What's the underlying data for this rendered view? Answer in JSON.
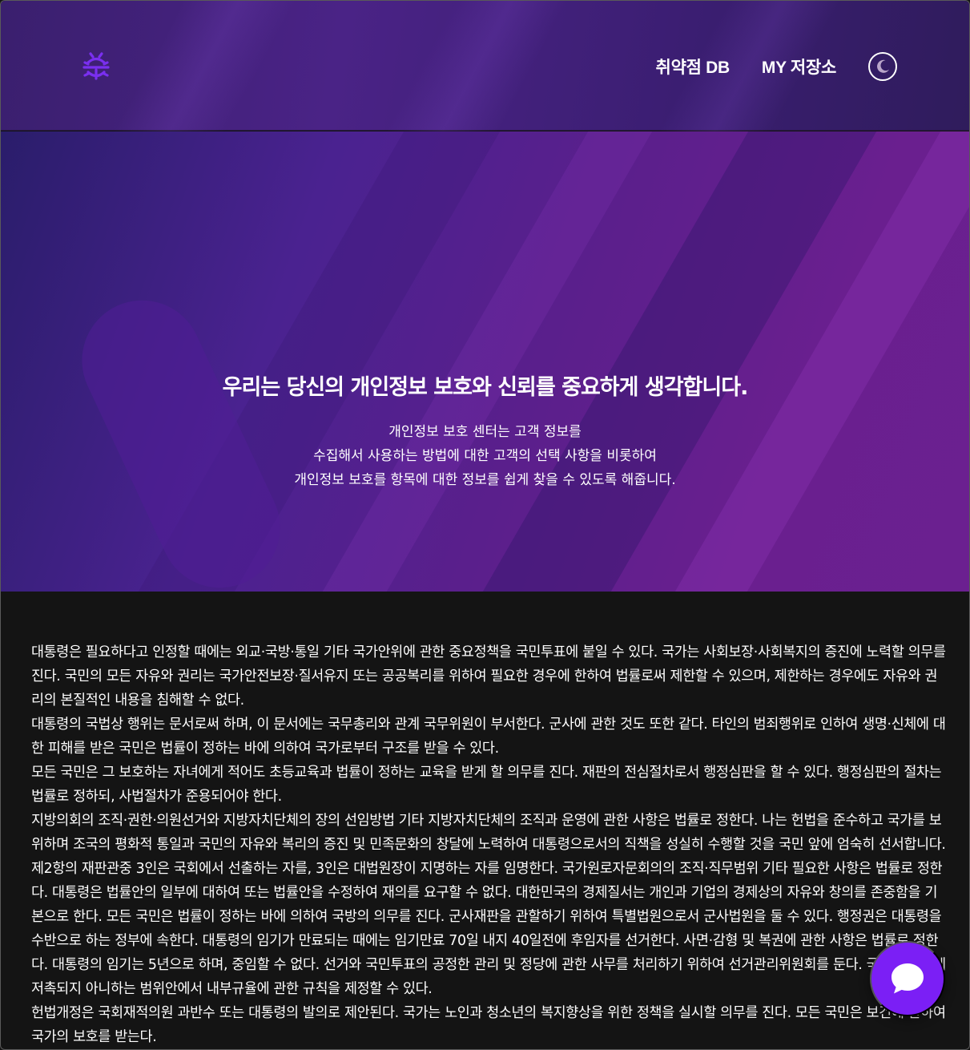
{
  "header": {
    "logo_icon": "bug-shield-logo-icon",
    "nav": [
      {
        "label": "취약점 DB"
      },
      {
        "label": "MY 저장소"
      }
    ],
    "theme_toggle_icon": "moon-icon"
  },
  "hero": {
    "title": "우리는 당신의 개인정보 보호와 신뢰를 중요하게 생각합니다.",
    "lines": [
      "개인정보 보호 센터는 고객 정보를",
      "수집해서 사용하는 방법에 대한 고객의 선택 사항을 비롯하여",
      "개인정보 보호를 항목에 대한 정보를 쉽게 찾을 수 있도록 해줍니다."
    ]
  },
  "content": {
    "paragraphs": [
      "대통령은 필요하다고 인정할 때에는 외교·국방·통일 기타 국가안위에 관한 중요정책을 국민투표에 붙일 수 있다. 국가는 사회보장·사회복지의 증진에 노력할 의무를 진다. 국민의 모든 자유와 권리는 국가안전보장·질서유지 또는 공공복리를 위하여 필요한 경우에 한하여 법률로써 제한할 수 있으며, 제한하는 경우에도 자유와 권리의 본질적인 내용을 침해할 수 없다.",
      "대통령의 국법상 행위는 문서로써 하며, 이 문서에는 국무총리와 관계 국무위원이 부서한다. 군사에 관한 것도 또한 같다. 타인의 범죄행위로 인하여 생명·신체에 대한 피해를 받은 국민은 법률이 정하는 바에 의하여 국가로부터 구조를 받을 수 있다.",
      "모든 국민은 그 보호하는 자녀에게 적어도 초등교육과 법률이 정하는 교육을 받게 할 의무를 진다. 재판의 전심절차로서 행정심판을 할 수 있다. 행정심판의 절차는 법률로 정하되, 사법절차가 준용되어야 한다.",
      "지방의회의 조직·권한·의원선거와 지방자치단체의 장의 선임방법 기타 지방자치단체의 조직과 운영에 관한 사항은 법률로 정한다. 나는 헌법을 준수하고 국가를 보위하며 조국의 평화적 통일과 국민의 자유와 복리의 증진 및 민족문화의 창달에 노력하여 대통령으로서의 직책을 성실히 수행할 것을 국민 앞에 엄숙히 선서합니다. 제2항의 재판관중 3인은 국회에서 선출하는 자를, 3인은 대법원장이 지명하는 자를 임명한다. 국가원로자문회의의 조직·직무범위 기타 필요한 사항은 법률로 정한다. 대통령은 법률안의 일부에 대하여 또는 법률안을 수정하여 재의를 요구할 수 없다. 대한민국의 경제질서는 개인과 기업의 경제상의 자유와 창의를 존중함을 기본으로 한다. 모든 국민은 법률이 정하는 바에 의하여 국방의 의무를 진다. 군사재판을 관할하기 위하여 특별법원으로서 군사법원을 둘 수 있다. 행정권은 대통령을 수반으로 하는 정부에 속한다. 대통령의 임기가 만료되는 때에는 임기만료 70일 내지 40일전에 후임자를 선거한다. 사면·감형 및 복권에 관한 사항은 법률로 정한다. 대통령의 임기는 5년으로 하며, 중임할 수 없다. 선거와 국민투표의 공정한 관리 및 정당에 관한 사무를 처리하기 위하여 선거관리위원회를 둔다. 국회는 법률에 저촉되지 아니하는 범위안에서 내부규율에 관한 규칙을 제정할 수 있다.",
      "헌법개정은 국회재적의원 과반수 또는 대통령의 발의로 제안된다. 국가는 노인과 청소년의 복지향상을 위한 정책을 실시할 의무를 진다. 모든 국민은 보건에 관하여 국가의 보호를 받는다."
    ]
  },
  "chat": {
    "icon": "chat-bubble-icon",
    "accent": "#7b1ff5"
  }
}
